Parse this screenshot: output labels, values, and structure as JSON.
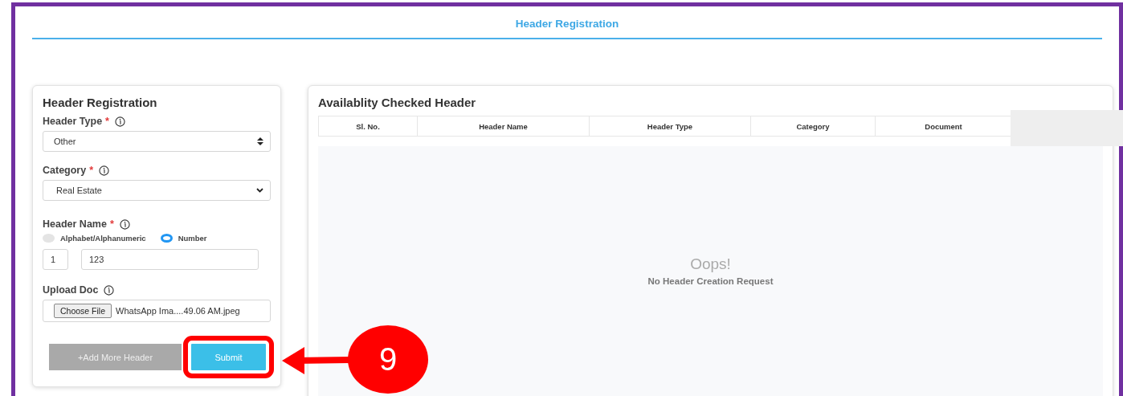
{
  "page_title": "Header Registration",
  "form": {
    "title": "Header Registration",
    "header_type": {
      "label": "Header Type",
      "required_mark": "*",
      "value": "Other"
    },
    "category": {
      "label": "Category",
      "required_mark": "*",
      "value": "Real Estate"
    },
    "header_name": {
      "label": "Header Name",
      "required_mark": "*",
      "options": [
        {
          "label": "Alphabet/Alphanumeric",
          "selected": false
        },
        {
          "label": "Number",
          "selected": true
        }
      ],
      "prefix": "1",
      "value": "123"
    },
    "upload": {
      "label": "Upload Doc",
      "button": "Choose File",
      "file_name": "WhatsApp Ima....49.06 AM.jpeg"
    },
    "buttons": [
      {
        "label": "+Add More Header",
        "kind": "secondary"
      },
      {
        "label": "Submit",
        "kind": "primary"
      }
    ]
  },
  "table": {
    "title": "Availablity Checked Header",
    "columns": [
      "Sl. No.",
      "Header Name",
      "Header Type",
      "Category",
      "Document"
    ],
    "empty_title": "Oops!",
    "empty_message": "No Header Creation Request"
  },
  "annotation": {
    "step": "9"
  }
}
